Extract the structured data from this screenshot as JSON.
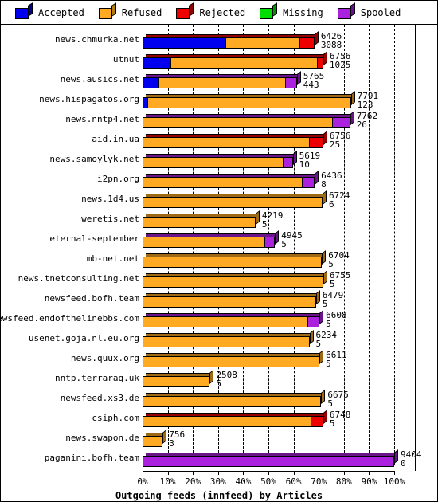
{
  "legend": {
    "items": [
      {
        "label": "Accepted",
        "color": "#0000ee",
        "side": "#00008b",
        "icon": "cube-icon"
      },
      {
        "label": "Refused",
        "color": "#ffaa22",
        "side": "#b37a10",
        "icon": "cube-icon"
      },
      {
        "label": "Rejected",
        "color": "#ee0000",
        "side": "#8b0000",
        "icon": "cube-icon"
      },
      {
        "label": "Missing",
        "color": "#00dd00",
        "side": "#009000",
        "icon": "cube-icon"
      },
      {
        "label": "Spooled",
        "color": "#aa22dd",
        "side": "#6a0f94",
        "icon": "cube-icon"
      }
    ]
  },
  "chart_data": {
    "type": "bar",
    "orientation": "horizontal",
    "stacked": true,
    "title": "Outgoing feeds (innfeed) by Articles",
    "xlabel": "Outgoing feeds (innfeed) by Articles",
    "ylabel": "",
    "xlim": [
      0,
      100
    ],
    "xticks": [
      "0%",
      "10%",
      "20%",
      "30%",
      "40%",
      "50%",
      "60%",
      "70%",
      "80%",
      "90%",
      "100%"
    ],
    "xtick_values": [
      0,
      10,
      20,
      30,
      40,
      50,
      60,
      70,
      80,
      90,
      100
    ],
    "grid": "vertical-dashed",
    "legend_position": "top",
    "series": [
      {
        "name": "Accepted",
        "color": "#0000ee"
      },
      {
        "name": "Refused",
        "color": "#ffaa22"
      },
      {
        "name": "Rejected",
        "color": "#ee0000"
      },
      {
        "name": "Missing",
        "color": "#00dd00"
      },
      {
        "name": "Spooled",
        "color": "#aa22dd"
      }
    ],
    "categories": [
      "news.chmurka.net",
      "utnut",
      "news.ausics.net",
      "news.hispagatos.org",
      "news.nntp4.net",
      "aid.in.ua",
      "news.samoylyk.net",
      "i2pn.org",
      "news.1d4.us",
      "weretis.net",
      "eternal-september",
      "mb-net.net",
      "news.tnetconsulting.net",
      "newsfeed.bofh.team",
      "newsfeed.endofthelinebbs.com",
      "usenet.goja.nl.eu.org",
      "news.quux.org",
      "nntp.terraraq.uk",
      "newsfeed.xs3.de",
      "csiph.com",
      "news.swapon.de",
      "paganini.bofh.team"
    ],
    "rows": [
      {
        "label": "news.chmurka.net",
        "total": 6426,
        "second": 3088,
        "pct": 68.3,
        "segments": [
          {
            "series": "Accepted",
            "pct": 33.3
          },
          {
            "series": "Refused",
            "pct": 29.5
          },
          {
            "series": "Rejected",
            "pct": 5.5
          }
        ]
      },
      {
        "label": "utnut",
        "total": 6756,
        "second": 1025,
        "pct": 71.8,
        "segments": [
          {
            "series": "Accepted",
            "pct": 10.9
          },
          {
            "series": "Refused",
            "pct": 59.0
          },
          {
            "series": "Rejected",
            "pct": 1.9
          }
        ]
      },
      {
        "label": "news.ausics.net",
        "total": 5765,
        "second": 443,
        "pct": 61.3,
        "segments": [
          {
            "series": "Accepted",
            "pct": 6.2
          },
          {
            "series": "Refused",
            "pct": 51.0
          },
          {
            "series": "Spooled",
            "pct": 4.1
          }
        ]
      },
      {
        "label": "news.hispagatos.org",
        "total": 7791,
        "second": 123,
        "pct": 82.8,
        "segments": [
          {
            "series": "Accepted",
            "pct": 1.6
          },
          {
            "series": "Refused",
            "pct": 81.2
          }
        ]
      },
      {
        "label": "news.nntp4.net",
        "total": 7762,
        "second": 26,
        "pct": 82.5,
        "segments": [
          {
            "series": "Refused",
            "pct": 76.0
          },
          {
            "series": "Spooled",
            "pct": 6.5
          }
        ]
      },
      {
        "label": "aid.in.ua",
        "total": 6756,
        "second": 25,
        "pct": 71.8,
        "segments": [
          {
            "series": "Refused",
            "pct": 66.8
          },
          {
            "series": "Rejected",
            "pct": 5.0
          }
        ]
      },
      {
        "label": "news.samoylyk.net",
        "total": 5619,
        "second": 10,
        "pct": 59.7,
        "segments": [
          {
            "series": "Refused",
            "pct": 56.2
          },
          {
            "series": "Spooled",
            "pct": 3.5
          }
        ]
      },
      {
        "label": "i2pn.org",
        "total": 6436,
        "second": 8,
        "pct": 68.4,
        "segments": [
          {
            "series": "Refused",
            "pct": 63.9
          },
          {
            "series": "Spooled",
            "pct": 4.5
          }
        ]
      },
      {
        "label": "news.1d4.us",
        "total": 6724,
        "second": 6,
        "pct": 71.5,
        "segments": [
          {
            "series": "Refused",
            "pct": 71.5
          }
        ]
      },
      {
        "label": "weretis.net",
        "total": 4219,
        "second": 5,
        "pct": 44.9,
        "segments": [
          {
            "series": "Refused",
            "pct": 44.9
          }
        ]
      },
      {
        "label": "eternal-september",
        "total": 4945,
        "second": 5,
        "pct": 52.6,
        "segments": [
          {
            "series": "Refused",
            "pct": 48.9
          },
          {
            "series": "Spooled",
            "pct": 3.7
          }
        ]
      },
      {
        "label": "mb-net.net",
        "total": 6704,
        "second": 5,
        "pct": 71.3,
        "segments": [
          {
            "series": "Refused",
            "pct": 71.3
          }
        ]
      },
      {
        "label": "news.tnetconsulting.net",
        "total": 6755,
        "second": 5,
        "pct": 71.8,
        "segments": [
          {
            "series": "Refused",
            "pct": 71.8
          }
        ]
      },
      {
        "label": "newsfeed.bofh.team",
        "total": 6479,
        "second": 5,
        "pct": 68.9,
        "segments": [
          {
            "series": "Refused",
            "pct": 68.9
          }
        ]
      },
      {
        "label": "newsfeed.endofthelinebbs.com",
        "total": 6608,
        "second": 5,
        "pct": 70.3,
        "segments": [
          {
            "series": "Refused",
            "pct": 66.1
          },
          {
            "series": "Spooled",
            "pct": 4.2
          }
        ]
      },
      {
        "label": "usenet.goja.nl.eu.org",
        "total": 6234,
        "second": 5,
        "pct": 66.3,
        "segments": [
          {
            "series": "Refused",
            "pct": 66.3
          }
        ]
      },
      {
        "label": "news.quux.org",
        "total": 6611,
        "second": 5,
        "pct": 70.3,
        "segments": [
          {
            "series": "Refused",
            "pct": 70.3
          }
        ]
      },
      {
        "label": "nntp.terraraq.uk",
        "total": 2508,
        "second": 5,
        "pct": 26.7,
        "segments": [
          {
            "series": "Refused",
            "pct": 26.7
          }
        ]
      },
      {
        "label": "newsfeed.xs3.de",
        "total": 6675,
        "second": 5,
        "pct": 71.0,
        "segments": [
          {
            "series": "Refused",
            "pct": 71.0
          }
        ]
      },
      {
        "label": "csiph.com",
        "total": 6748,
        "second": 5,
        "pct": 71.8,
        "segments": [
          {
            "series": "Refused",
            "pct": 67.3
          },
          {
            "series": "Rejected",
            "pct": 4.5
          }
        ]
      },
      {
        "label": "news.swapon.de",
        "total": 756,
        "second": 3,
        "pct": 8.0,
        "segments": [
          {
            "series": "Refused",
            "pct": 8.0
          }
        ]
      },
      {
        "label": "paganini.bofh.team",
        "total": 9404,
        "second": 0,
        "pct": 100.0,
        "segments": [
          {
            "series": "Spooled",
            "pct": 100.0
          }
        ]
      }
    ]
  }
}
